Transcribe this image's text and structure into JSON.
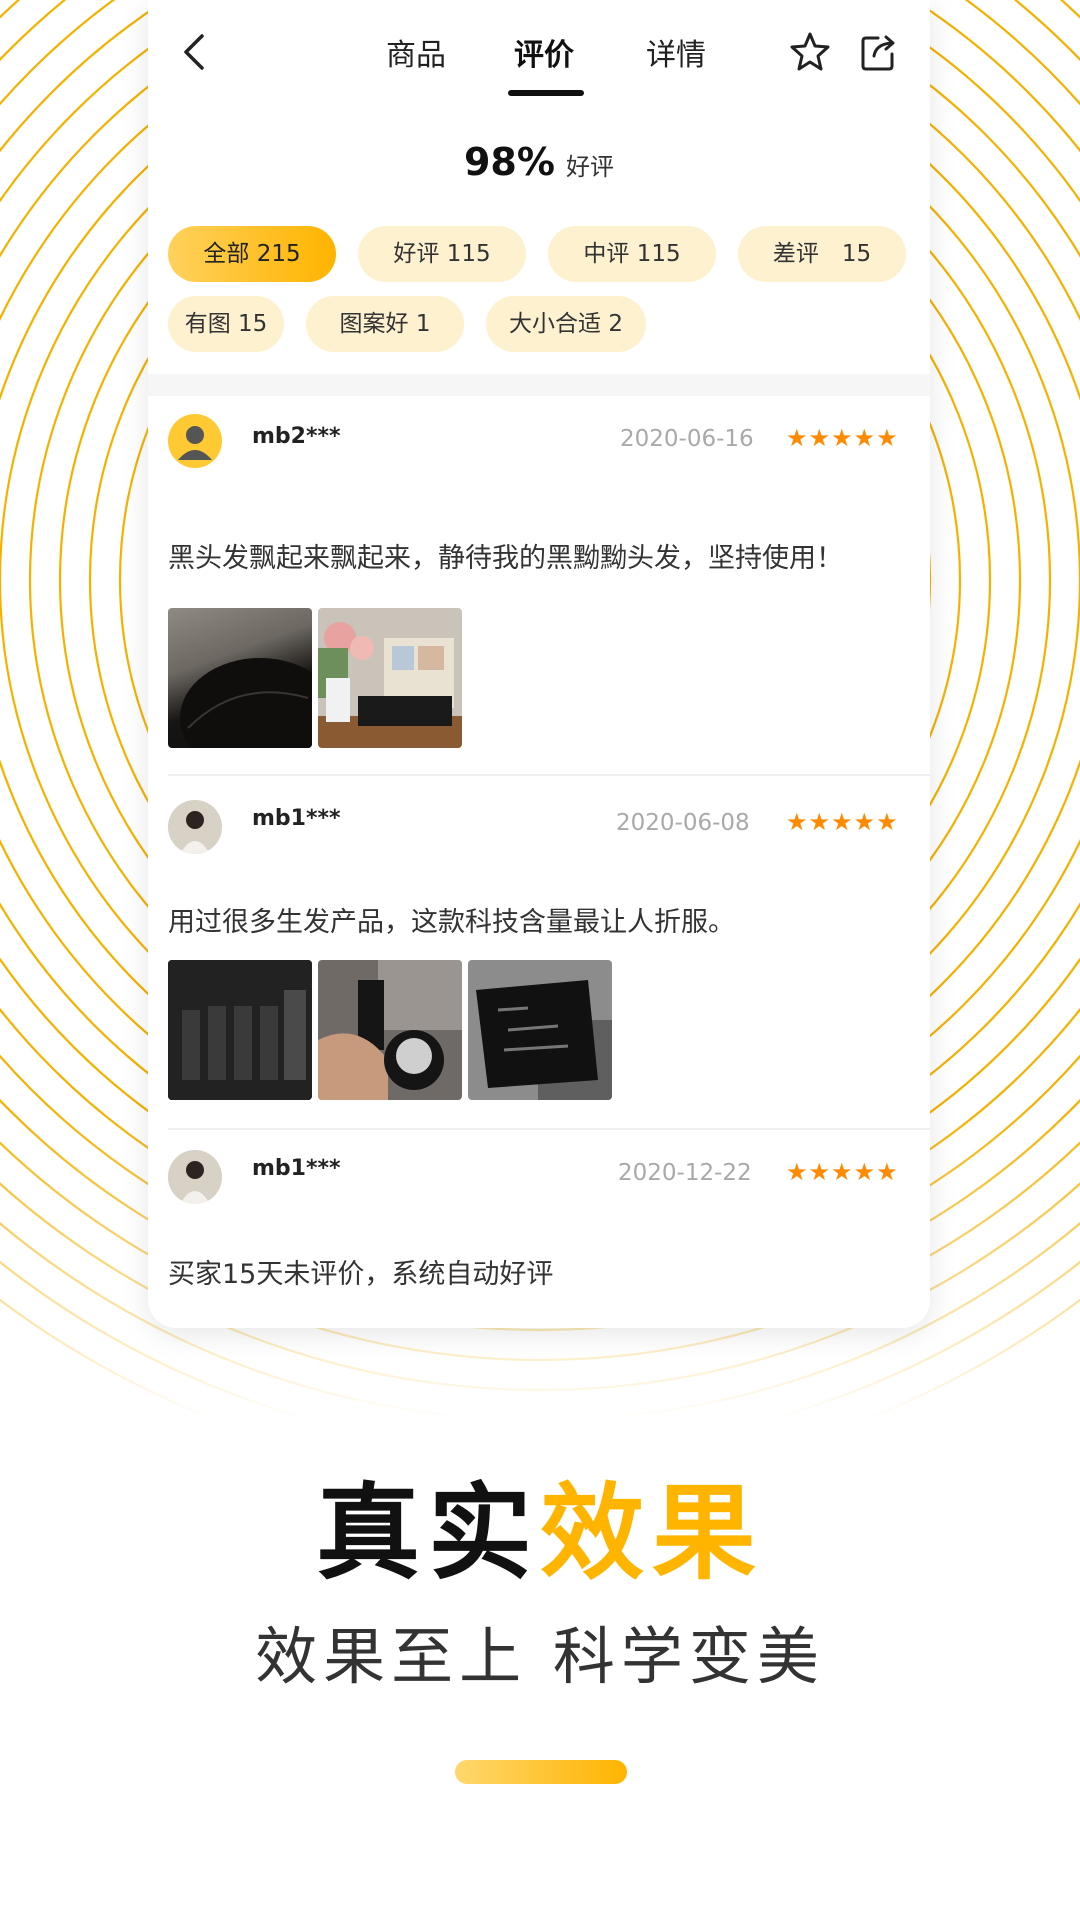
{
  "tabs": [
    {
      "label": "商品"
    },
    {
      "label": "评价"
    },
    {
      "label": "详情"
    }
  ],
  "rating": {
    "percent": "98%",
    "label": "好评"
  },
  "filters": [
    {
      "label": "全部 215",
      "active": true
    },
    {
      "label": "好评 115"
    },
    {
      "label": "中评 115"
    },
    {
      "label": "差评　15"
    },
    {
      "label": "有图 15"
    },
    {
      "label": "图案好 1"
    },
    {
      "label": "大小合适 2"
    }
  ],
  "reviews": [
    {
      "user": "mb2***",
      "date": "2020-06-16",
      "stars": "★★★★★",
      "text": "黑头发飘起来飘起来，静待我的黑黝黝头发，坚持使用！",
      "images": 2
    },
    {
      "user": "mb1***",
      "date": "2020-06-08",
      "stars": "★★★★★",
      "text": "用过很多生发产品，这款科技含量最让人折服。",
      "images": 3
    },
    {
      "user": "mb1***",
      "date": "2020-12-22",
      "stars": "★★★★★",
      "text": "买家15天未评价，系统自动好评",
      "images": 0
    }
  ],
  "headline": {
    "black": "真实",
    "gold": "效果"
  },
  "subtitle": "效果至上  科学变美",
  "colors": {
    "accent": "#ffb400",
    "chip_bg": "#fdf1cf",
    "star": "#ff8a00"
  },
  "icons": {
    "back": "chevron-left-icon",
    "favorite": "star-outline-icon",
    "share": "share-icon"
  }
}
